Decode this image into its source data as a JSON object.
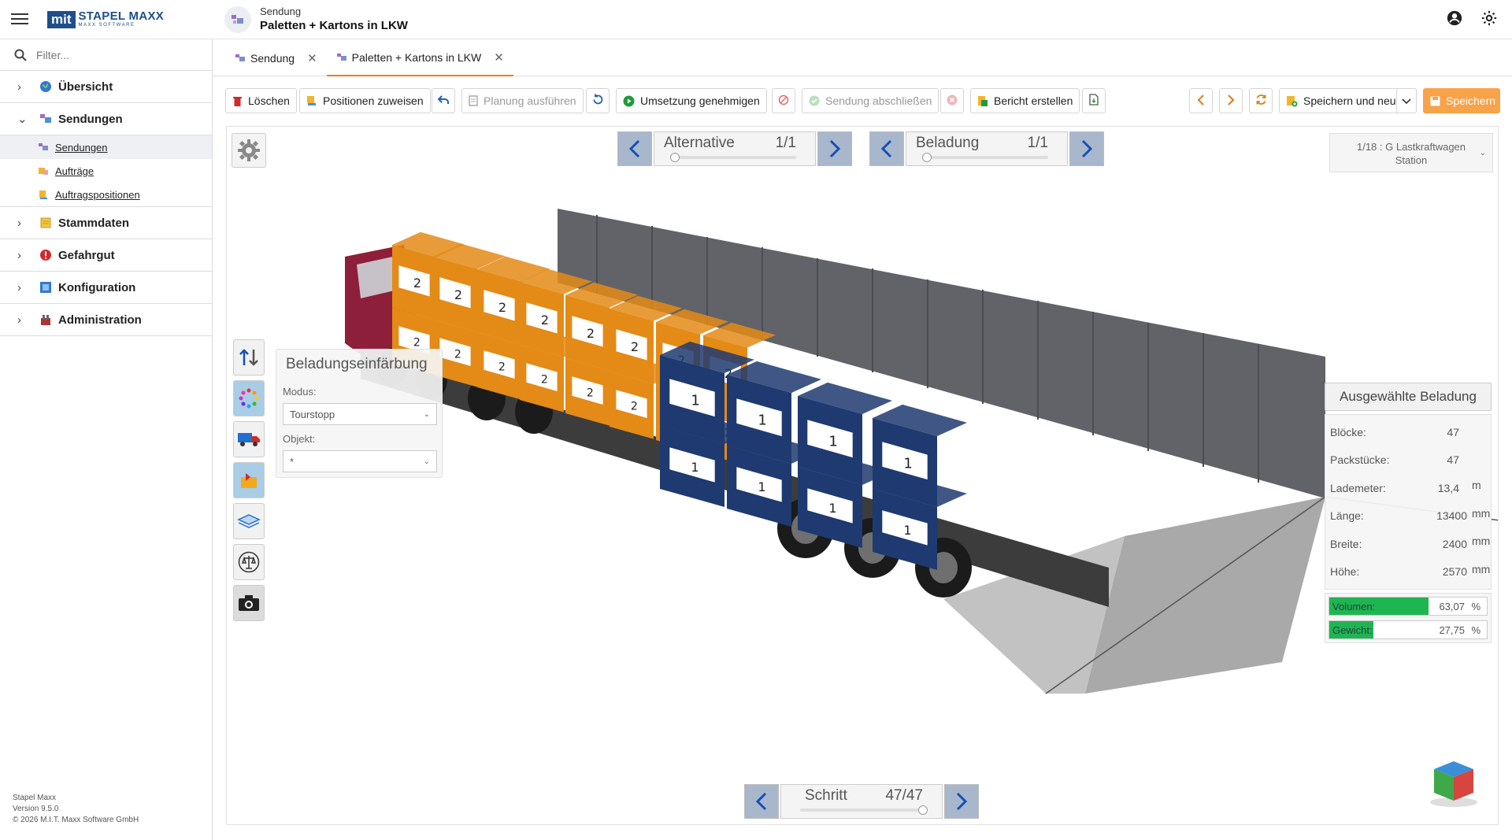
{
  "app": {
    "logo_abbr": "mit",
    "logo_name": "STAPEL MAXX",
    "logo_sub": "MAXX SOFTWARE"
  },
  "header": {
    "subtitle": "Sendung",
    "title": "Paletten + Kartons in LKW"
  },
  "sidebar": {
    "filter_placeholder": "Filter...",
    "items": [
      {
        "label": "Übersicht",
        "icon": "globe-icon"
      },
      {
        "label": "Sendungen",
        "icon": "shipment-icon",
        "expanded": true,
        "children": [
          {
            "label": "Sendungen",
            "active": true
          },
          {
            "label": "Aufträge"
          },
          {
            "label": "Auftragspositionen"
          }
        ]
      },
      {
        "label": "Stammdaten",
        "icon": "database-icon"
      },
      {
        "label": "Gefahrgut",
        "icon": "hazard-icon"
      },
      {
        "label": "Konfiguration",
        "icon": "config-icon"
      },
      {
        "label": "Administration",
        "icon": "admin-icon"
      }
    ],
    "footer": {
      "line1": "Stapel Maxx",
      "line2": "Version 9.5.0",
      "line3": "© 2026 M.I.T. Maxx Software GmbH"
    }
  },
  "tabs": [
    {
      "label": "Sendung",
      "active": false
    },
    {
      "label": "Paletten + Kartons in LKW",
      "active": true
    }
  ],
  "toolbar": {
    "delete": "Löschen",
    "assign": "Positionen zuweisen",
    "plan": "Planung ausführen",
    "approve": "Umsetzung genehmigen",
    "complete": "Sendung abschließen",
    "report": "Bericht erstellen",
    "save_new": "Speichern und neu",
    "save": "Speichern"
  },
  "viewer": {
    "alternative": {
      "label": "Alternative",
      "value": "1/1"
    },
    "beladung": {
      "label": "Beladung",
      "value": "1/1"
    },
    "stop": {
      "line1": "1/18 : G Lastkraftwagen",
      "line2": "Station"
    },
    "coloring": {
      "title": "Beladungseinfärbung",
      "mode_label": "Modus:",
      "mode_value": "Tourstopp",
      "object_label": "Objekt:",
      "object_value": "*"
    },
    "selection": {
      "title": "Ausgewählte Beladung",
      "rows": [
        {
          "label": "Blöcke:",
          "value": "47",
          "unit": ""
        },
        {
          "label": "Packstücke:",
          "value": "47",
          "unit": ""
        },
        {
          "label": "Lademeter:",
          "value": "13,4",
          "unit": "m"
        },
        {
          "label": "Länge:",
          "value": "13400",
          "unit": "mm"
        },
        {
          "label": "Breite:",
          "value": "2400",
          "unit": "mm"
        },
        {
          "label": "Höhe:",
          "value": "2570",
          "unit": "mm"
        }
      ],
      "volume": {
        "label": "Volumen:",
        "value": "63,07",
        "unit": "%",
        "fraction": 0.6307
      },
      "weight": {
        "label": "Gewicht:",
        "value": "27,75",
        "unit": "%",
        "fraction": 0.2775
      }
    },
    "step": {
      "label": "Schritt",
      "value": "47/47"
    },
    "cargo_labels": {
      "orange": "2",
      "blue": "1"
    },
    "colors": {
      "orange": "#e48a16",
      "blue": "#1e3a70",
      "truck": "#8e1f3a",
      "accent": "#f07c1c",
      "bar": "#1fb551"
    }
  }
}
